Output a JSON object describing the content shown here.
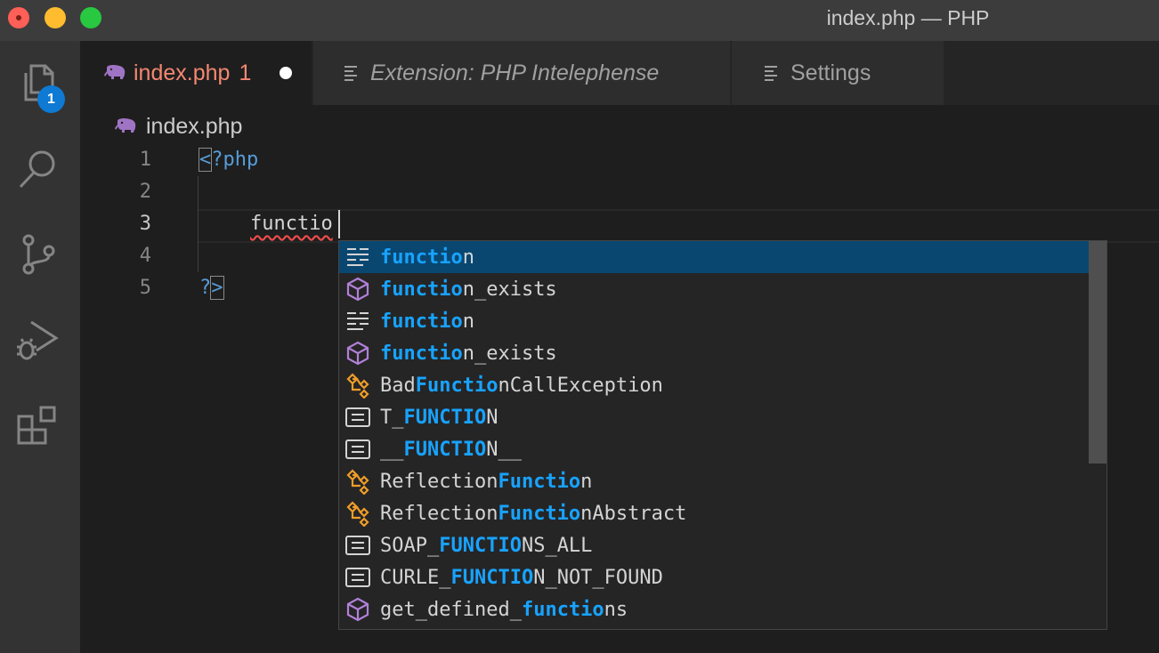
{
  "window": {
    "title": "index.php — PHP"
  },
  "activity_bar": {
    "explorer_badge": "1",
    "icons": [
      "files-icon",
      "search-icon",
      "source-control-icon",
      "debug-icon",
      "extensions-icon"
    ]
  },
  "tabs": [
    {
      "label": "index.php",
      "problems": "1",
      "active": true,
      "dirty": true,
      "icon": "php-elephant-icon"
    },
    {
      "label": "Extension: PHP Intelephense",
      "active": false,
      "icon": "lines-icon"
    },
    {
      "label": "Settings",
      "active": false,
      "icon": "lines-icon"
    }
  ],
  "breadcrumb": {
    "file": "index.php"
  },
  "editor": {
    "line_numbers": [
      "1",
      "2",
      "3",
      "4",
      "5"
    ],
    "current_line": "3",
    "lines": {
      "open_bracket": "<",
      "open_rest": "?php",
      "typed": "functio",
      "close_q": "?",
      "close_bracket": ">"
    }
  },
  "suggestions": [
    {
      "kind": "keyword",
      "pre": "",
      "match": "functio",
      "post": "n",
      "selected": true
    },
    {
      "kind": "method",
      "pre": "",
      "match": "functio",
      "post": "n_exists"
    },
    {
      "kind": "keyword",
      "pre": "",
      "match": "functio",
      "post": "n"
    },
    {
      "kind": "method",
      "pre": "",
      "match": "functio",
      "post": "n_exists"
    },
    {
      "kind": "class",
      "pre": "Bad",
      "match": "Functio",
      "post": "nCallException"
    },
    {
      "kind": "constant",
      "pre": "T_",
      "match": "FUNCTIO",
      "post": "N"
    },
    {
      "kind": "constant",
      "pre": "__",
      "match": "FUNCTIO",
      "post": "N__"
    },
    {
      "kind": "class",
      "pre": "Reflection",
      "match": "Functio",
      "post": "n"
    },
    {
      "kind": "class",
      "pre": "Reflection",
      "match": "Functio",
      "post": "nAbstract"
    },
    {
      "kind": "constant",
      "pre": "SOAP_",
      "match": "FUNCTIO",
      "post": "NS_ALL"
    },
    {
      "kind": "constant",
      "pre": "CURLE_",
      "match": "FUNCTIO",
      "post": "N_NOT_FOUND"
    },
    {
      "kind": "method",
      "pre": "get_defined_",
      "match": "functio",
      "post": "ns"
    }
  ],
  "colors": {
    "accent": "#0e7ad3",
    "match_highlight": "#18a3ff",
    "selected_row": "#094771",
    "error_tab": "#f48771",
    "method_icon": "#b180d7",
    "class_icon": "#ee9d28",
    "php_icon": "#a074c4"
  }
}
